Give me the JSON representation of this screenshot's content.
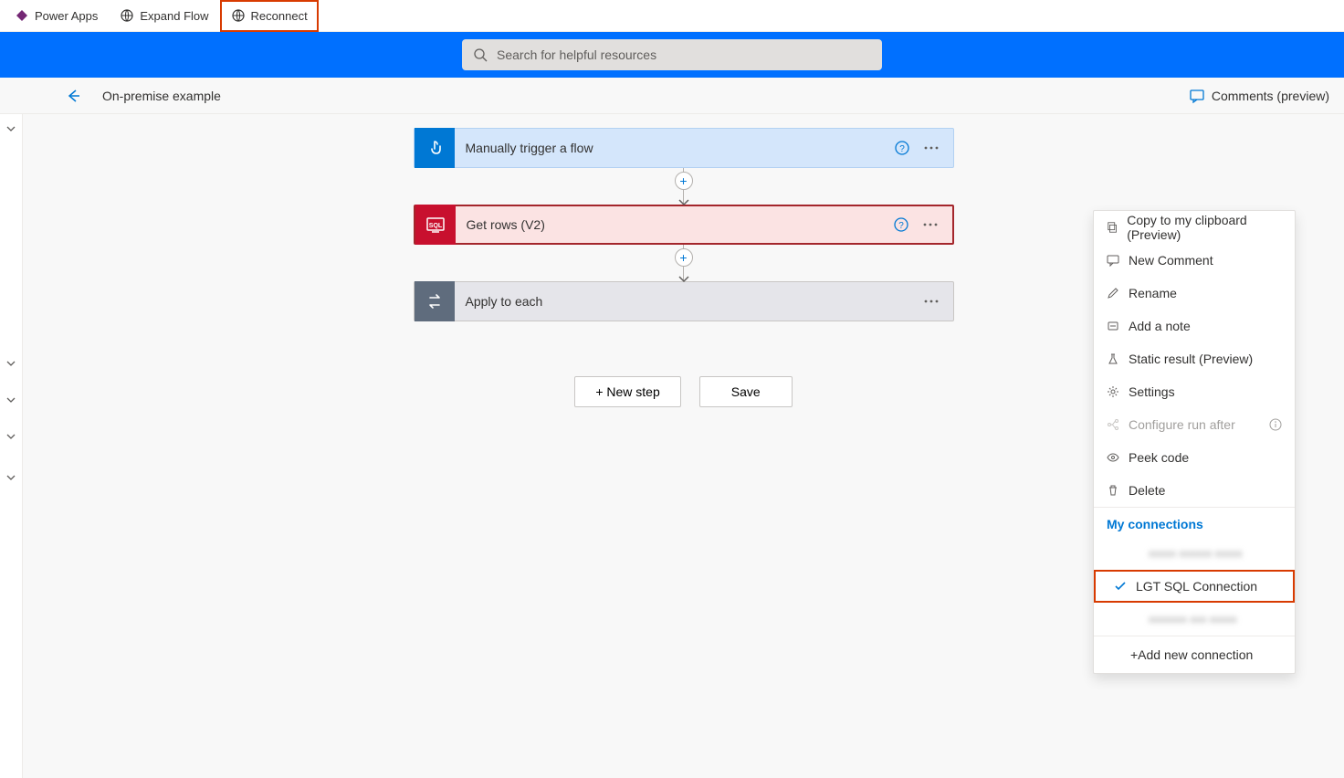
{
  "tabs": {
    "power_apps": "Power Apps",
    "expand_flow": "Expand Flow",
    "reconnect": "Reconnect"
  },
  "search": {
    "placeholder": "Search for helpful resources"
  },
  "subheader": {
    "title": "On-premise example",
    "comments": "Comments (preview)"
  },
  "steps": {
    "trigger": {
      "title": "Manually trigger a flow"
    },
    "get_rows": {
      "title": "Get rows (V2)"
    },
    "apply": {
      "title": "Apply to each"
    }
  },
  "actions": {
    "new_step": "+ New step",
    "save": "Save"
  },
  "context_menu": {
    "copy": "Copy to my clipboard (Preview)",
    "new_comment": "New Comment",
    "rename": "Rename",
    "add_note": "Add a note",
    "static_result": "Static result (Preview)",
    "settings": "Settings",
    "configure_run_after": "Configure run after",
    "peek_code": "Peek code",
    "delete": "Delete",
    "my_connections": "My connections",
    "connections": {
      "blurred1": "xxxxx xxxxxx xxxxx",
      "selected": "LGT SQL Connection",
      "blurred2": "xxxxxxx xxx xxxxx"
    },
    "add_new": "+Add new connection"
  }
}
